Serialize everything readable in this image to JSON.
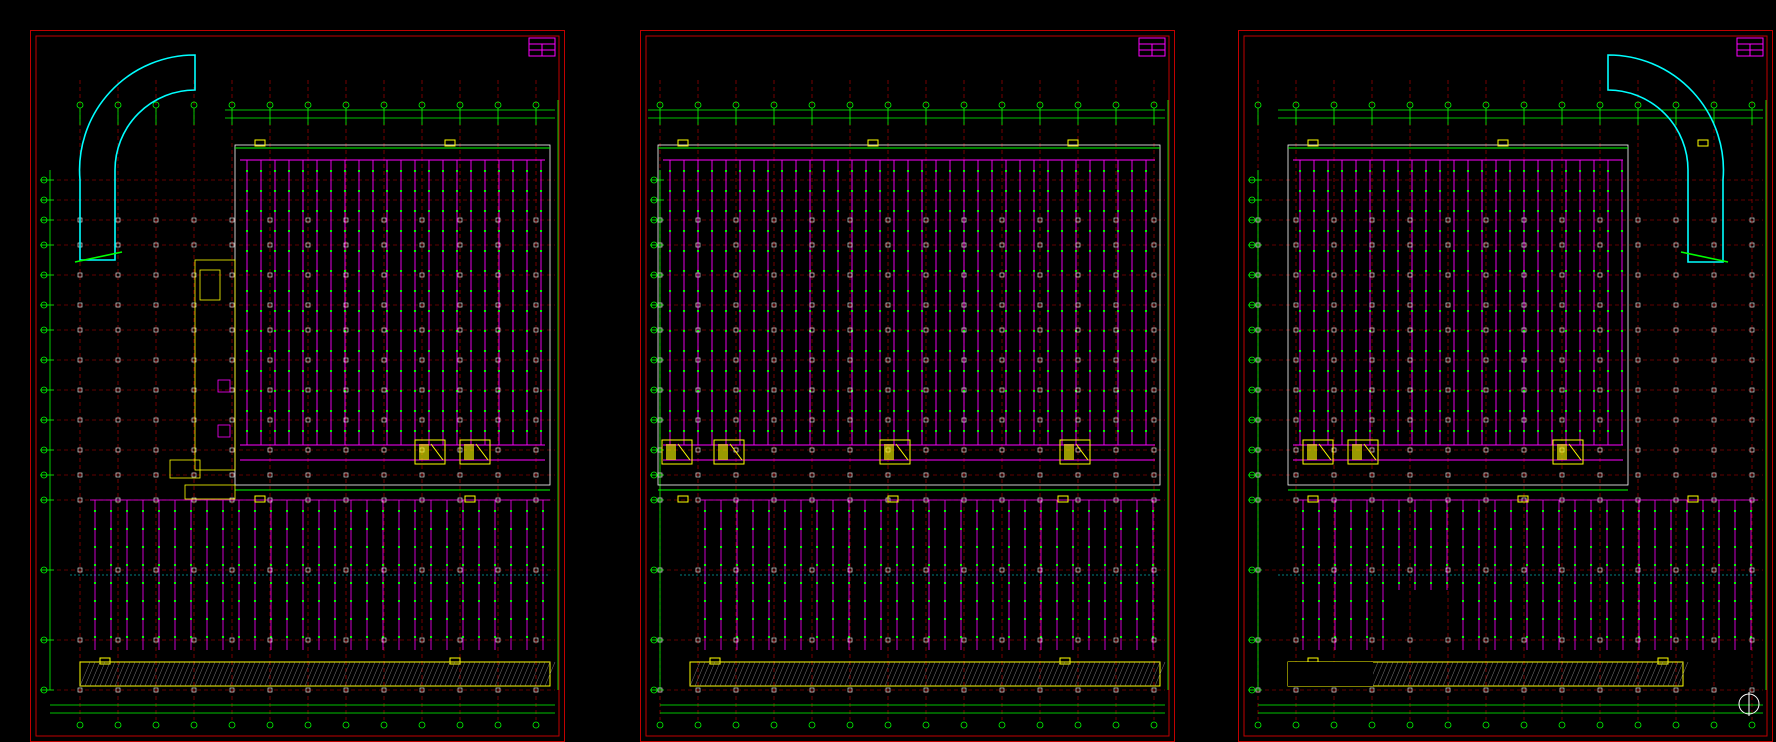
{
  "app": {
    "title": "",
    "canvas_background": "#000000"
  },
  "colors": {
    "frame": "#c00000",
    "grid": "#00ff00",
    "axis_dashed": "#c00000",
    "conduit": "#ff00ff",
    "device": "#ffff00",
    "ramp": "#00ffff",
    "dots": "#00ff00"
  },
  "sheets": [
    {
      "id": "sheet-1",
      "has_ramp": "left",
      "has_annex": true
    },
    {
      "id": "sheet-2",
      "has_ramp": "none",
      "has_annex": false
    },
    {
      "id": "sheet-3",
      "has_ramp": "right",
      "has_annex": false
    }
  ],
  "icons": {
    "title_block": "title-block-icon",
    "north_arrow": "north-arrow-icon",
    "fire_hydrant": "hydrant-box-icon"
  }
}
